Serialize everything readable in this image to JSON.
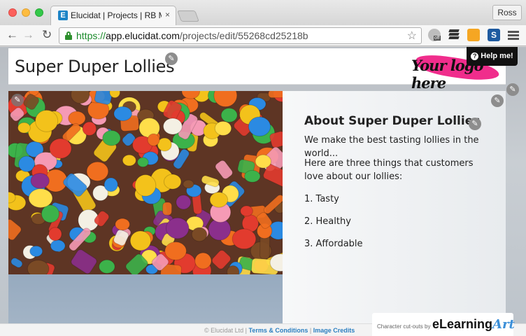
{
  "browser": {
    "tab_favicon": "E",
    "tab_title": "Elucidat | Projects | RB Ma",
    "tab_close": "×",
    "user": "Ross",
    "url_scheme": "https://",
    "url_host": "app.elucidat.com",
    "url_path": "/projects/edit/55268cd25218b",
    "icons": [
      "back-arrow-icon",
      "forward-arrow-icon",
      "reload-icon",
      "lock-icon",
      "star-icon",
      "owl-extension-icon",
      "buffer-extension-icon",
      "note-extension-icon",
      "s-extension-icon",
      "hamburger-menu-icon"
    ],
    "owl_badge": "off"
  },
  "page": {
    "title": "Super Duper Lollies",
    "logo_text": "Your logo here",
    "help_label": "Help me!",
    "edit_icon": "✎",
    "info": {
      "heading": "About Super Duper Lollies",
      "intro": "We make the best tasting lollies in the world...",
      "lead": "Here are three things that customers love about our lollies:",
      "items": [
        "1. Tasty",
        "2. Healthy",
        "3. Affordable"
      ]
    },
    "footer": {
      "copyright": "© Elucidat Ltd",
      "separator": " | ",
      "terms": "Terms & Conditions",
      "credits": "Image Credits"
    },
    "credit": {
      "small": "Character cut-outs by",
      "brand": "eLearning",
      "brand_art": "Art"
    }
  },
  "colors": {
    "accent": "#2a7fc1",
    "logo_pink": "#f02d8c",
    "secure_green": "#1a8a2a"
  }
}
